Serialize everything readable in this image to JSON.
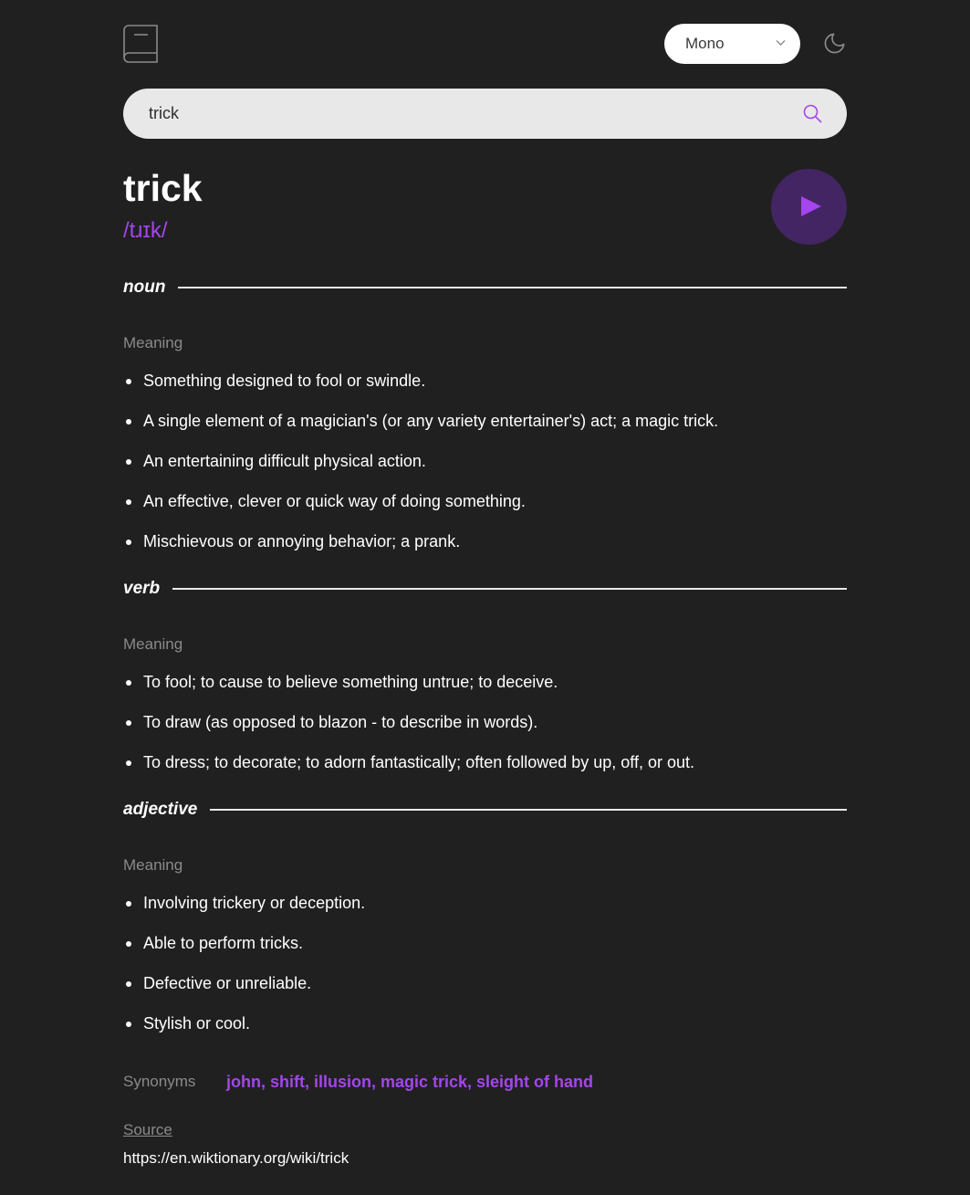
{
  "header": {
    "font_selector": {
      "value": "Mono"
    }
  },
  "search": {
    "value": "trick"
  },
  "entry": {
    "word": "trick",
    "phonetic": "/tɹɪk/"
  },
  "meanings": [
    {
      "part_of_speech": "noun",
      "meaning_label": "Meaning",
      "definitions": [
        "Something designed to fool or swindle.",
        "A single element of a magician's (or any variety entertainer's) act; a magic trick.",
        "An entertaining difficult physical action.",
        "An effective, clever or quick way of doing something.",
        "Mischievous or annoying behavior; a prank."
      ]
    },
    {
      "part_of_speech": "verb",
      "meaning_label": "Meaning",
      "definitions": [
        "To fool; to cause to believe something untrue; to deceive.",
        "To draw (as opposed to blazon - to describe in words).",
        "To dress; to decorate; to adorn fantastically; often followed by up, off, or out."
      ]
    },
    {
      "part_of_speech": "adjective",
      "meaning_label": "Meaning",
      "definitions": [
        "Involving trickery or deception.",
        "Able to perform tricks.",
        "Defective or unreliable.",
        "Stylish or cool."
      ]
    }
  ],
  "synonyms": {
    "label": "Synonyms",
    "values": "john, shift, illusion, magic trick, sleight of hand"
  },
  "source": {
    "label": "Source",
    "url": "https://en.wiktionary.org/wiki/trick"
  },
  "theme": {
    "accent": "#a445ed",
    "background": "#202020"
  },
  "icons": {
    "logo": "book-icon",
    "dropdown": "chevron-down-icon",
    "theme": "moon-icon",
    "search": "search-icon",
    "play": "play-icon"
  }
}
